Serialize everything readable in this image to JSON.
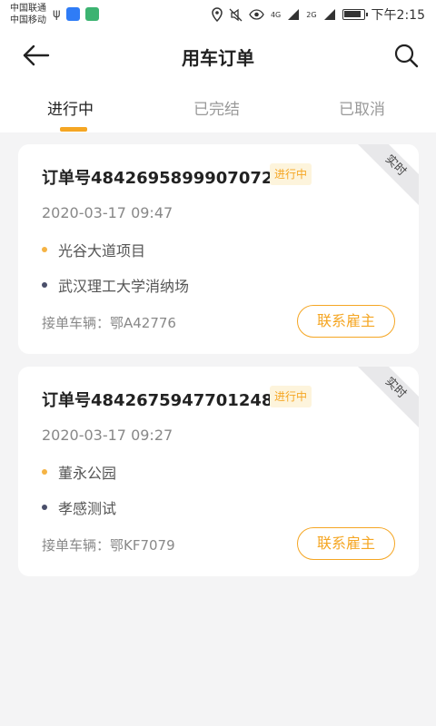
{
  "status_bar": {
    "carrier_1": "中国联通",
    "carrier_2": "中国移动",
    "network_4g": "4G",
    "network_2g": "2G",
    "time": "下午2:15"
  },
  "header": {
    "title": "用车订单",
    "back_icon": "arrow-left-icon",
    "search_icon": "search-icon"
  },
  "tabs": [
    {
      "label": "进行中",
      "active": true
    },
    {
      "label": "已完结",
      "active": false
    },
    {
      "label": "已取消",
      "active": false
    }
  ],
  "orders": [
    {
      "order_no": "订单号4842695899907072",
      "status": "进行中",
      "type_tag": "实时",
      "datetime": "2020-03-17 09:47",
      "start": "光谷大道项目",
      "end": "武汉理工大学消纳场",
      "vehicle": "接单车辆：鄂A42776",
      "contact_label": "联系雇主"
    },
    {
      "order_no": "订单号4842675947701248",
      "status": "进行中",
      "type_tag": "实时",
      "datetime": "2020-03-17 09:27",
      "start": "董永公园",
      "end": "孝感测试",
      "vehicle": "接单车辆：鄂KF7079",
      "contact_label": "联系雇主"
    }
  ],
  "colors": {
    "accent": "#f5a623",
    "background": "#f4f4f5",
    "start_dot": "#f5b344",
    "end_dot": "#4a4f6a"
  }
}
